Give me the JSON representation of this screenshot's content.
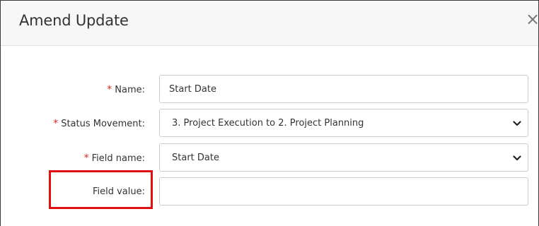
{
  "dialog": {
    "title": "Amend Update",
    "close_glyph": "×"
  },
  "form": {
    "required_marker": "*",
    "name": {
      "label": "Name:",
      "value": "Start Date"
    },
    "status_movement": {
      "label": "Status Movement:",
      "value": "3. Project Execution to 2. Project Planning"
    },
    "field_name": {
      "label": "Field name:",
      "value": "Start Date"
    },
    "field_value": {
      "label": "Field value:",
      "value": ""
    }
  },
  "colors": {
    "required": "#d42a2a",
    "highlight": "#e01010",
    "header_bg": "#f7f7f7"
  },
  "icons": {
    "close": "close-icon",
    "dropdown": "chevron-down-icon"
  }
}
